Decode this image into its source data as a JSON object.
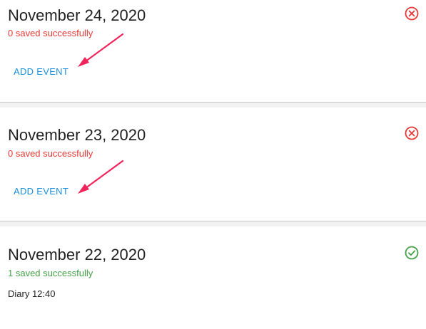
{
  "days": [
    {
      "date": "November 24, 2020",
      "status_text": "0 saved successfully",
      "status": "error",
      "status_icon": "x-circle-icon",
      "action_label": "ADD EVENT",
      "annotation": "red-arrow-pointing-to-add-event"
    },
    {
      "date": "November 23, 2020",
      "status_text": "0 saved successfully",
      "status": "error",
      "status_icon": "x-circle-icon",
      "action_label": "ADD EVENT",
      "annotation": "red-arrow-pointing-to-add-event"
    },
    {
      "date": "November 22, 2020",
      "status_text": "1 saved successfully",
      "status": "success",
      "status_icon": "check-circle-icon",
      "entries": [
        "Diary 12:40"
      ]
    }
  ],
  "colors": {
    "error": "#e53935",
    "success": "#43a047",
    "link": "#1a8fd8",
    "annotation_arrow": "#f0245b"
  }
}
